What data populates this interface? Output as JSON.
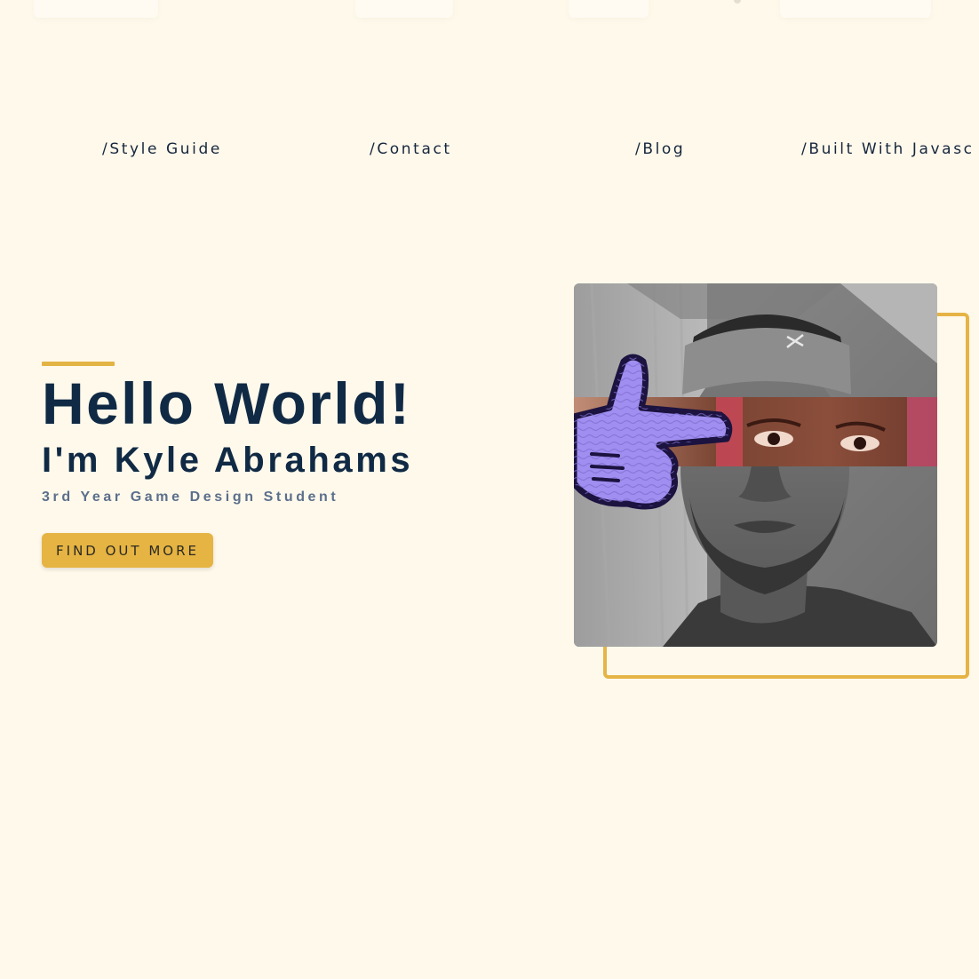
{
  "nav": {
    "links": [
      {
        "label": "/Style Guide"
      },
      {
        "label": "/Contact"
      },
      {
        "label": "/Blog"
      },
      {
        "label": "/Built With Javasc"
      }
    ]
  },
  "hero": {
    "title": "Hello World!",
    "subtitle": "I'm Kyle Abrahams",
    "tagline": "3rd Year Game Design Student",
    "cta_label": "FIND OUT MORE"
  },
  "colors": {
    "background": "#fff9eb",
    "text_dark": "#102a45",
    "text_muted": "#5b6f8c",
    "accent": "#e5b445"
  },
  "icons": {
    "portrait_overlay": "pointing-hand-icon"
  }
}
